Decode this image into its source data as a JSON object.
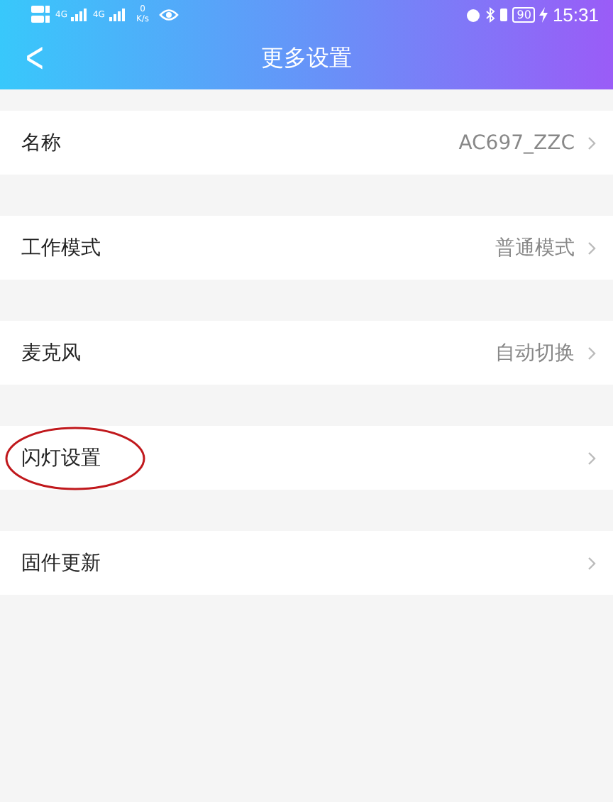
{
  "status_bar": {
    "signal_1": "4G",
    "signal_2": "4G",
    "speed_value": "0",
    "speed_unit": "K/s",
    "battery": "90",
    "time": "15:31"
  },
  "header": {
    "back": "<",
    "title": "更多设置"
  },
  "rows": [
    {
      "label": "名称",
      "value": "AC697_ZZC",
      "circled": false
    },
    {
      "label": "工作模式",
      "value": "普通模式",
      "circled": false
    },
    {
      "label": "麦克风",
      "value": "自动切换",
      "circled": false
    },
    {
      "label": "闪灯设置",
      "circled": true
    },
    {
      "label": "固件更新",
      "circled": false
    }
  ]
}
